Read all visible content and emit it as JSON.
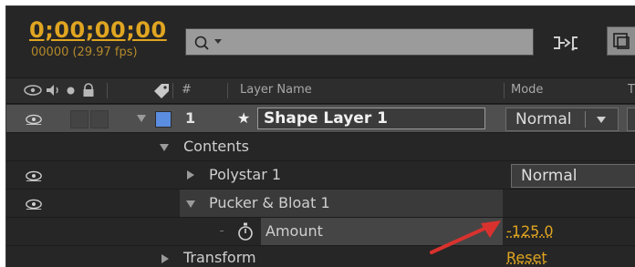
{
  "header": {
    "timecode": "0;00;00;00",
    "frames_fps": "00000 (29.97 fps)",
    "search": {
      "placeholder": ""
    }
  },
  "columns": {
    "number": "#",
    "layer_name": "Layer Name",
    "mode": "Mode",
    "trkmat_partial": "T"
  },
  "layers": [
    {
      "number": "1",
      "name": "Shape Layer 1",
      "mode": "Normal",
      "label_color": "#5b8de0"
    }
  ],
  "tree": {
    "contents": "Contents",
    "polystar": {
      "label": "Polystar 1",
      "mode": "Normal"
    },
    "pucker": {
      "label": "Pucker & Bloat 1"
    },
    "amount": {
      "label": "Amount",
      "value": "-125.0"
    },
    "transform": {
      "label": "Transform",
      "reset": "Reset"
    }
  },
  "colors": {
    "accent_orange": "#e0a521",
    "panel_bg": "#262626",
    "arrow_red": "#d9322e"
  }
}
